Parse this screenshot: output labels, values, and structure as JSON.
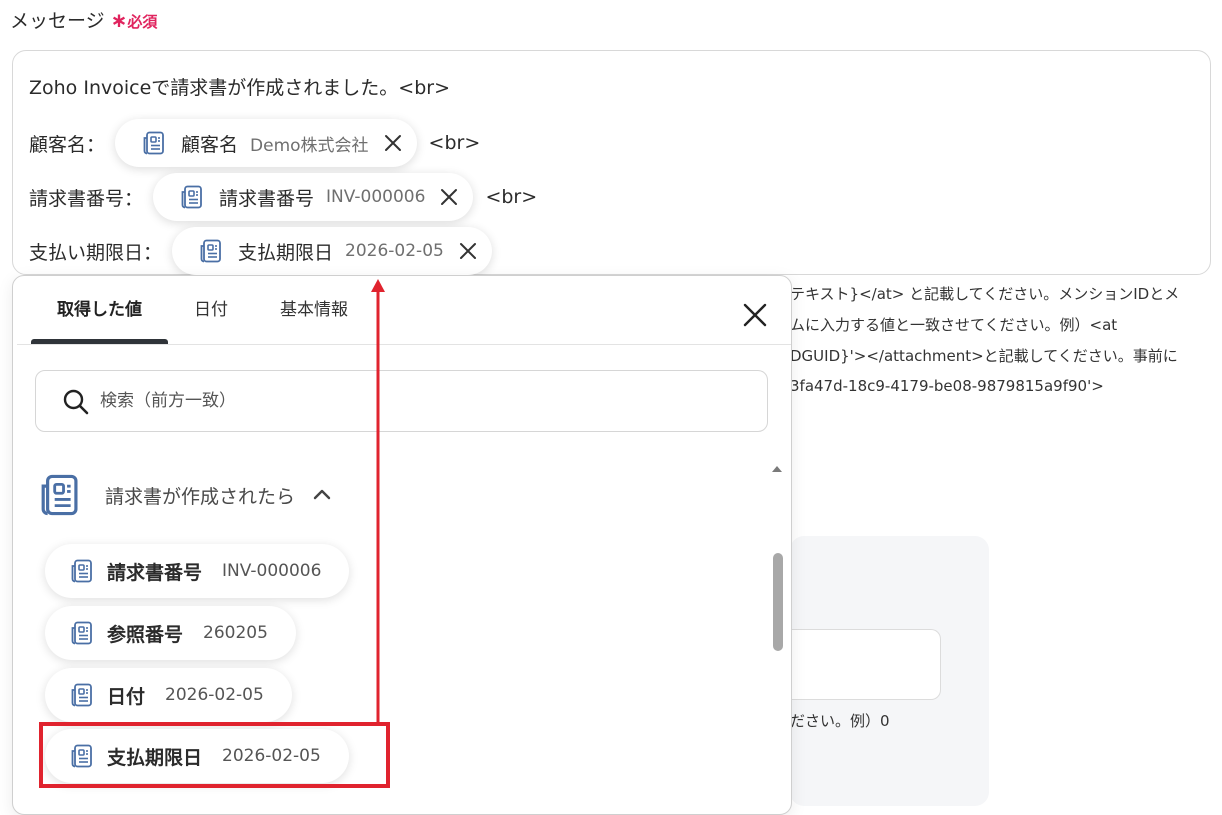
{
  "field": {
    "label": "メッセージ",
    "required_mark": "∗",
    "required_text": "必須"
  },
  "editor": {
    "line1": "Zoho Invoiceで請求書が作成されました。<br>",
    "line2": {
      "prefix": "顧客名：",
      "chip_name": "顧客名",
      "chip_value": "Demo株式会社",
      "suffix": "<br>"
    },
    "line3": {
      "prefix": "請求書番号：",
      "chip_name": "請求書番号",
      "chip_value": "INV-000006",
      "suffix": "<br>"
    },
    "line4": {
      "prefix": "支払い期限日：",
      "chip_name": "支払期限日",
      "chip_value": "2026-02-05"
    }
  },
  "help_text": [
    "テキスト}</at> と記載してください。メンションIDとメ",
    "ムに入力する値と一致させてください。例）<at",
    "DGUID}'></attachment>と記載してください。事前に",
    "3fa47d-18c9-4179-be08-9879815a9f90'>"
  ],
  "background_hint": "ださい。例）0",
  "dropdown": {
    "tabs": [
      {
        "label": "取得した値",
        "active": true
      },
      {
        "label": "日付",
        "active": false
      },
      {
        "label": "基本情報",
        "active": false
      }
    ],
    "search_placeholder": "検索（前方一致）",
    "section_title": "請求書が作成されたら",
    "items": [
      {
        "name": "請求書番号",
        "value": "INV-000006"
      },
      {
        "name": "参照番号",
        "value": "260205"
      },
      {
        "name": "日付",
        "value": "2026-02-05"
      },
      {
        "name": "支払期限日",
        "value": "2026-02-05"
      }
    ]
  },
  "icons": {
    "chip_icon": "document-icon",
    "remove_icon": "close-icon",
    "search_icon": "search-icon",
    "collapse_icon": "chevron-up-icon"
  },
  "colors": {
    "required": "#e0245e",
    "icon": "#4a6fa5",
    "highlight": "#e0232e",
    "tab_indicator": "#2f3439"
  }
}
